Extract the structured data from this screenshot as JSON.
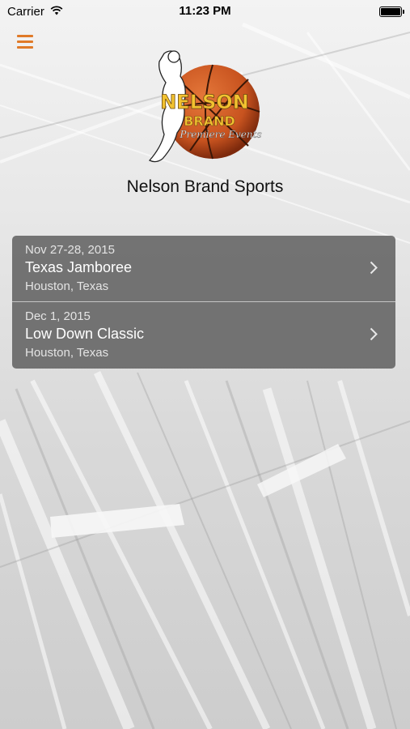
{
  "status_bar": {
    "carrier": "Carrier",
    "time": "11:23 PM"
  },
  "header": {
    "menu_icon": "hamburger-icon",
    "title": "Nelson Brand Sports"
  },
  "logo": {
    "line1": "NELSON",
    "line2": "BRAND",
    "line3": "Premiere Events"
  },
  "events": [
    {
      "date": "Nov 27-28, 2015",
      "name": "Texas Jamboree",
      "location": "Houston, Texas"
    },
    {
      "date": "Dec 1, 2015",
      "name": "Low Down Classic",
      "location": "Houston, Texas"
    }
  ],
  "colors": {
    "accent": "#e07a28",
    "basketball": "#c8531f",
    "logo_gold": "#f2c230",
    "row_bg": "#5f5f5f"
  }
}
